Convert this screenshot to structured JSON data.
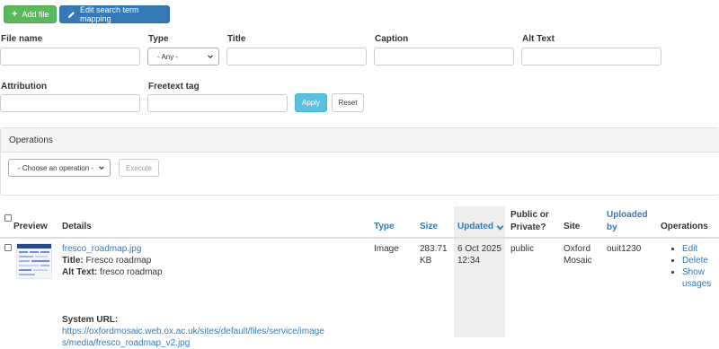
{
  "toolbar": {
    "add_file_label": "Add file",
    "edit_mapping_label": "Edit search term mapping"
  },
  "filters": {
    "file_name_label": "File name",
    "type_label": "Type",
    "type_value": "- Any -",
    "title_label": "Title",
    "caption_label": "Caption",
    "alt_text_label": "Alt Text",
    "attribution_label": "Attribution",
    "freetext_label": "Freetext tag",
    "apply_label": "Apply",
    "reset_label": "Reset"
  },
  "operations_panel": {
    "heading": "Operations",
    "select_value": "- Choose an operation -",
    "execute_label": "Execute"
  },
  "table": {
    "headers": {
      "preview": "Preview",
      "details": "Details",
      "type": "Type",
      "size": "Size",
      "updated": "Updated",
      "public_line1": "Public or",
      "public_line2": "Private?",
      "site": "Site",
      "uploaded_line1": "Uploaded",
      "uploaded_line2": "by",
      "operations": "Operations"
    },
    "rows": [
      {
        "filename": "fresco_roadmap.jpg",
        "title_label": "Title:",
        "title_value": "Fresco roadmap",
        "alt_label": "Alt Text:",
        "alt_value": "fresco roadmap",
        "type": "Image",
        "size_line1": "283.71",
        "size_line2": "KB",
        "updated_line1": "6 Oct 2025",
        "updated_line2": "12:34",
        "visibility": "public",
        "site_line1": "Oxford",
        "site_line2": "Mosaic",
        "uploaded_by": "ouit1230",
        "ops": [
          "Edit",
          "Delete",
          "Show",
          "usages"
        ],
        "system_url_label": "System URL:",
        "system_url_line1": "https://oxfordmosaic.web.ox.ac.uk/sites/default/files/service/image",
        "system_url_line2": "s/media/fresco_roadmap_v2.jpg"
      }
    ]
  },
  "colors": {
    "primary_blue": "#337ab7",
    "success_green": "#5cb85c",
    "apply_blue": "#5bc0de"
  }
}
